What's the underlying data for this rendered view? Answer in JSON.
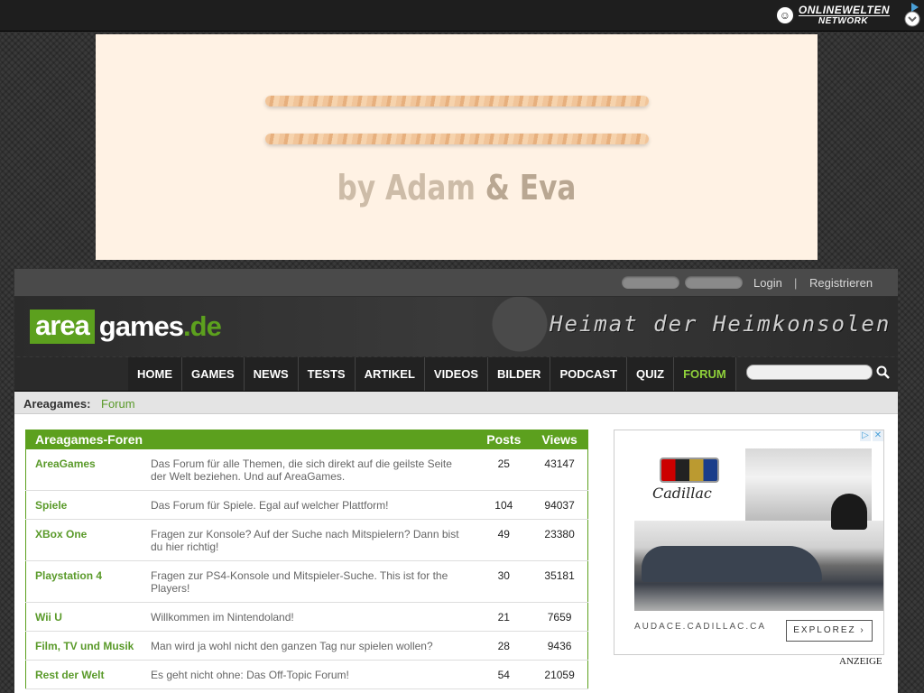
{
  "network": {
    "line1": "ONLINEWELTEN",
    "line2": "NETWORK"
  },
  "ad_banner": {
    "brand_text_1": "by Adam",
    "brand_text_2": "& Eva"
  },
  "userbar": {
    "login": "Login",
    "separator": "|",
    "register": "Registrieren"
  },
  "logo": {
    "part1": "area",
    "part2": "games",
    "part3": ".de"
  },
  "slogan": "Heimat der Heimkonsolen",
  "nav": [
    "HOME",
    "GAMES",
    "NEWS",
    "TESTS",
    "ARTIKEL",
    "VIDEOS",
    "BILDER",
    "PODCAST",
    "QUIZ",
    "FORUM"
  ],
  "nav_active": "FORUM",
  "breadcrumb": {
    "home": "Areagames:",
    "current": "Forum"
  },
  "forum_table": {
    "headers": {
      "title": "Areagames-Foren",
      "posts": "Posts",
      "views": "Views"
    },
    "rows": [
      {
        "name": "AreaGames",
        "desc": "Das Forum für alle Themen, die sich direkt auf die geilste Seite der Welt beziehen. Und auf AreaGames.",
        "posts": "25",
        "views": "43147"
      },
      {
        "name": "Spiele",
        "desc": "Das Forum für Spiele. Egal auf welcher Plattform!",
        "posts": "104",
        "views": "94037"
      },
      {
        "name": "XBox One",
        "desc": "Fragen zur Konsole? Auf der Suche nach Mitspielern? Dann bist du hier richtig!",
        "posts": "49",
        "views": "23380"
      },
      {
        "name": "Playstation 4",
        "desc": "Fragen zur PS4-Konsole und Mitspieler-Suche. This ist for the Players!",
        "posts": "30",
        "views": "35181"
      },
      {
        "name": "Wii U",
        "desc": "Willkommen im Nintendoland!",
        "posts": "21",
        "views": "7659"
      },
      {
        "name": "Film, TV und Musik",
        "desc": "Man wird ja wohl nicht den ganzen Tag nur spielen wollen?",
        "posts": "28",
        "views": "9436"
      },
      {
        "name": "Rest der Welt",
        "desc": "Es geht nicht ohne: Das Off-Topic Forum!",
        "posts": "54",
        "views": "21059"
      }
    ]
  },
  "side_ad": {
    "brand": "Cadillac",
    "url": "AUDACE.CADILLAC.CA",
    "cta": "EXPLOREZ ›",
    "label": "ANZEIGE"
  },
  "colors": {
    "accent": "#5ca01e",
    "nav_bg": "#222222",
    "banner_bg": "#fff2e4"
  }
}
